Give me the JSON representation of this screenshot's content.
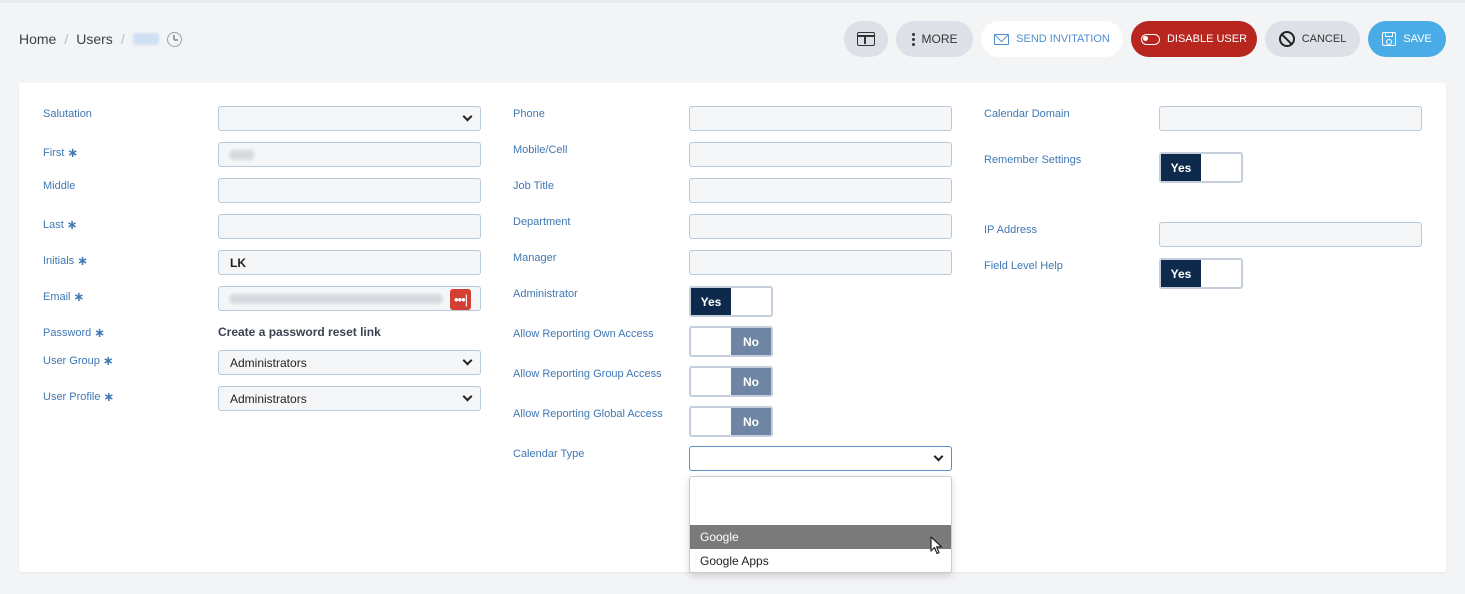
{
  "breadcrumb": {
    "home": "Home",
    "users": "Users"
  },
  "toolbar": {
    "more_label": "MORE",
    "invite_label": "SEND INVITATION",
    "disable_label": "DISABLE USER",
    "cancel_label": "CANCEL",
    "save_label": "SAVE"
  },
  "form": {
    "col1": {
      "salutation_label": "Salutation",
      "first_label": "First",
      "middle_label": "Middle",
      "last_label": "Last",
      "initials_label": "Initials",
      "initials_value": "LK",
      "email_label": "Email",
      "password_label": "Password",
      "password_link": "Create a password reset link",
      "user_group_label": "User Group",
      "user_group_value": "Administrators",
      "user_profile_label": "User Profile",
      "user_profile_value": "Administrators"
    },
    "col2": {
      "phone_label": "Phone",
      "mobile_label": "Mobile/Cell",
      "job_title_label": "Job Title",
      "department_label": "Department",
      "manager_label": "Manager",
      "administrator_label": "Administrator",
      "administrator_value": "Yes",
      "rep_own_label": "Allow Reporting Own Access",
      "rep_own_value": "No",
      "rep_group_label": "Allow Reporting Group Access",
      "rep_group_value": "No",
      "rep_global_label": "Allow Reporting Global Access",
      "rep_global_value": "No",
      "calendar_type_label": "Calendar Type",
      "calendar_options": [
        "",
        "Google",
        "Google Apps"
      ]
    },
    "col3": {
      "calendar_domain_label": "Calendar Domain",
      "remember_label": "Remember Settings",
      "remember_value": "Yes",
      "ip_label": "IP Address",
      "flh_label": "Field Level Help",
      "flh_value": "Yes"
    }
  },
  "colors": {
    "accent": "#4aace6",
    "danger": "#b7261f",
    "toggle_on": "#0d2a4d",
    "toggle_off": "#6e86a3",
    "label": "#3f78b4"
  }
}
